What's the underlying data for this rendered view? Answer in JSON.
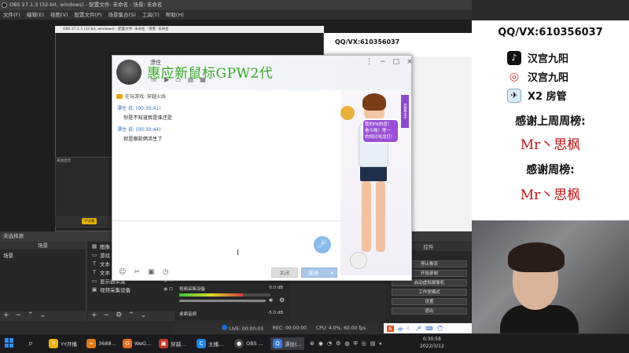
{
  "obs": {
    "title": "OBS 27.1.3 (32-bit, windows) - 配置文件: 未命名 - 场景: 未命名",
    "menu": [
      "文件(F)",
      "编辑(E)",
      "视图(V)",
      "配置文件(P)",
      "场景集合(S)",
      "工具(T)",
      "帮助(H)"
    ],
    "status_top": "未选择源",
    "nested_qq": "QQ/VX:610356037",
    "nested_left_title": "来源混音",
    "nested_yy": "YY开播",
    "scenes_header": "场景",
    "scene_item": "场景",
    "sources": [
      {
        "icon": "▦",
        "icon_name": "image-icon",
        "label": "图像"
      },
      {
        "icon": "▭",
        "icon_name": "game-capture-icon",
        "label": "游戏"
      },
      {
        "icon": "T",
        "icon_name": "text-icon",
        "label": "文本"
      },
      {
        "icon": "T",
        "icon_name": "text-icon",
        "label": "文本 (GDI+) 4"
      },
      {
        "icon": "▭",
        "icon_name": "monitor-icon",
        "label": "显示器采集"
      },
      {
        "icon": "▣",
        "icon_name": "camera-icon",
        "label": "视频采集设备"
      }
    ],
    "mixer": [
      {
        "label": "视频采集设备",
        "db": "0.0 dB"
      },
      {
        "label": "桌面音频",
        "db": "-5.0 dB"
      }
    ],
    "controls_header": "控件",
    "controls": [
      "停止推流",
      "开始录制",
      "启动虚拟摄像机",
      "工作室模式",
      "设置",
      "退出"
    ],
    "statusbar": {
      "live": "LIVE: 00:00:03",
      "rec": "REC: 00:00:00",
      "cpu": "CPU: 4.0%, 60.00 fps"
    }
  },
  "overlay": {
    "qq": "QQ/VX:610356037",
    "douyin": "汉宫九阳",
    "weibo": "汉宫九阳",
    "x2": "X2 房管",
    "thanks_last_week": "感谢上周周榜:",
    "name1": "Mr丶思枫",
    "thanks_week": "感谢周榜:",
    "name2": "Mr丶思枫"
  },
  "chat": {
    "contact_name": "漂住",
    "ad_text": "惠应新鼠标GPW2代",
    "game_line": "在玩游戏: 穿越火线",
    "messages": [
      {
        "meta": "漂住 说: (00:30:41)",
        "text": "你是不知道我是谁还是"
      },
      {
        "meta": "漂住 说: (00:30:44)",
        "text": "就是跟款俩活生了"
      }
    ],
    "character_bubble": "我的PK的感！ 看今晚！等一 的相比哈龙灯!",
    "character_ribbon": "恋爱王子",
    "close_btn": "关闭",
    "send_btn": "发送"
  },
  "taskbar": {
    "items": [
      {
        "name": "yy-app",
        "label": "YY开播",
        "color": "#f2b30a"
      },
      {
        "name": "app-3688",
        "label": "3688...",
        "color": "#e37a16"
      },
      {
        "name": "wechat-game",
        "label": "WeG...",
        "color": "#ea6b1a"
      },
      {
        "name": "chuanyue",
        "label": "穿越...",
        "color": "#c0392b"
      },
      {
        "name": "zhubo",
        "label": "主播...",
        "color": "#1e88e5"
      },
      {
        "name": "obs",
        "label": "OBS ...",
        "color": "#444"
      },
      {
        "name": "piaozhu",
        "label": "漂住(...",
        "color": "#3a7bd5"
      }
    ],
    "tray_lang": "中",
    "time": "0:30:58",
    "date": "2022/3/12"
  }
}
